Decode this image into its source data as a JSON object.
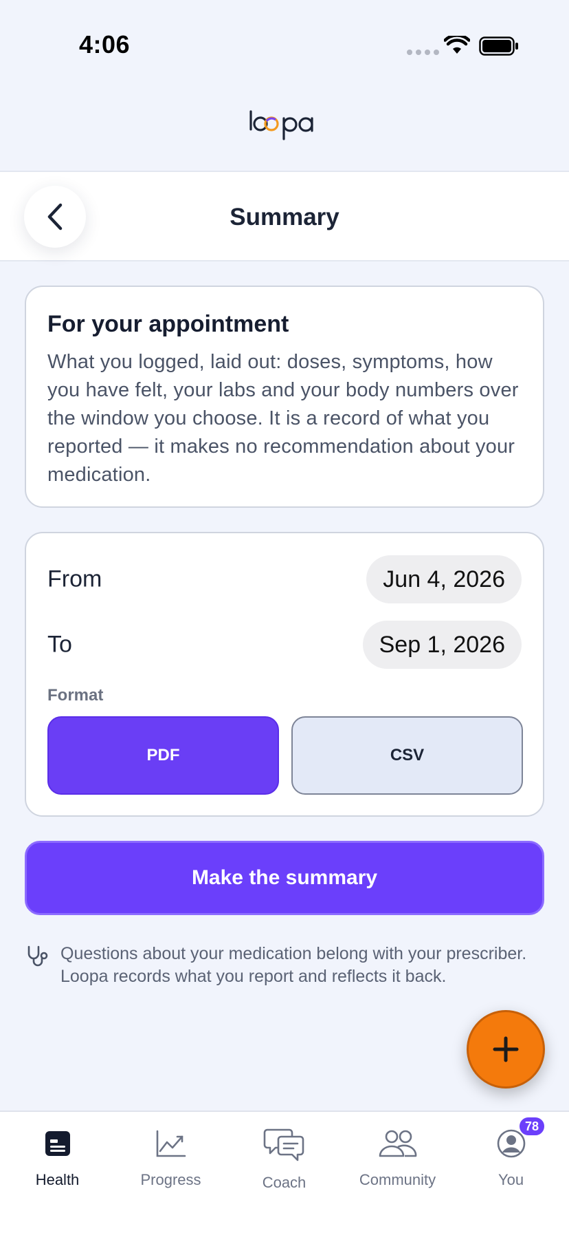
{
  "status_bar": {
    "time": "4:06"
  },
  "brand": {
    "name": "loopa"
  },
  "nav": {
    "title": "Summary",
    "back_icon": "chevron-left-icon"
  },
  "intro": {
    "title": "For your appointment",
    "body": "What you logged, laid out: doses, symptoms, how you have felt, your labs and your body numbers over the window you choose. It is a record of what you reported — it makes no recommendation about your medication."
  },
  "form": {
    "from_label": "From",
    "from_value": "Jun 4, 2026",
    "to_label": "To",
    "to_value": "Sep 1, 2026",
    "format_label": "Format",
    "formats": [
      {
        "label": "PDF",
        "selected": true
      },
      {
        "label": "CSV",
        "selected": false
      }
    ]
  },
  "cta": {
    "label": "Make the summary"
  },
  "note": {
    "icon": "stethoscope-icon",
    "text": "Questions about your medication belong with your prescriber. Loopa records what you report and reflects it back."
  },
  "fab": {
    "icon": "plus-icon"
  },
  "tabs": [
    {
      "label": "Health",
      "icon": "health-icon",
      "active": true
    },
    {
      "label": "Progress",
      "icon": "chart-icon",
      "active": false
    },
    {
      "label": "Coach",
      "icon": "chat-icon",
      "active": false
    },
    {
      "label": "Community",
      "icon": "people-icon",
      "active": false
    },
    {
      "label": "You",
      "icon": "profile-icon",
      "active": false,
      "badge": "78"
    }
  ],
  "colors": {
    "accent": "#6b3ffb",
    "fab": "#f47a0c",
    "background": "#f1f4fc"
  }
}
